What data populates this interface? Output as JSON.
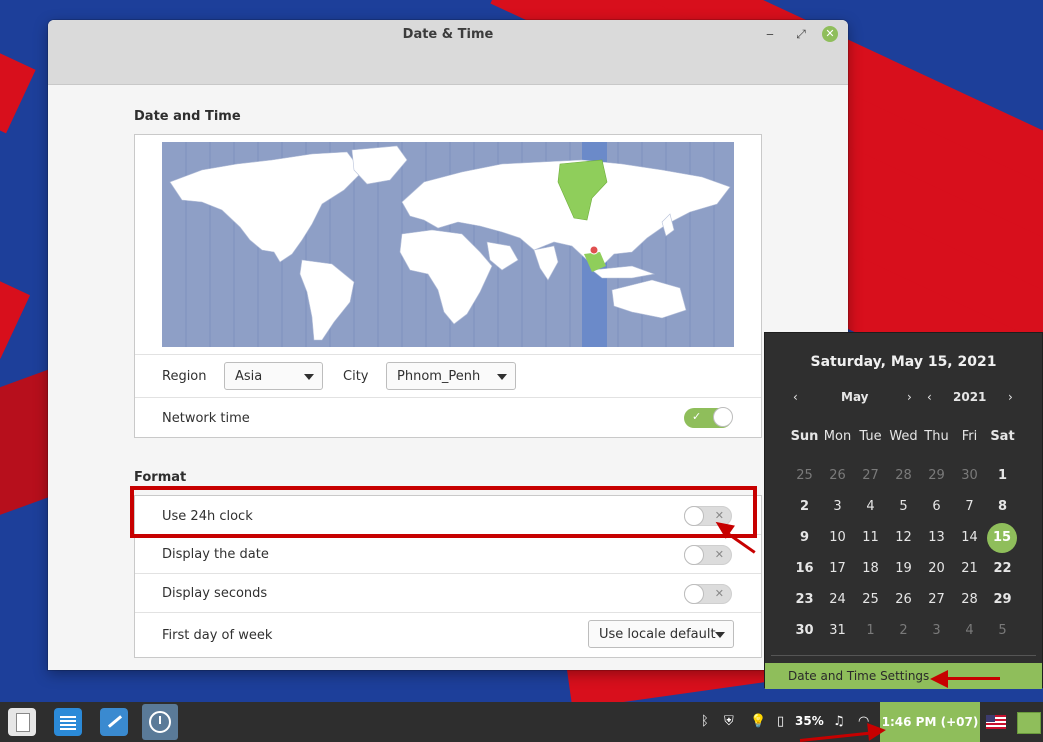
{
  "window": {
    "title": "Date & Time",
    "controls": {
      "minimize": "‒",
      "maximize": "⤢",
      "close": "✕"
    }
  },
  "date_time_section": {
    "title": "Date and Time",
    "region_label": "Region",
    "region_value": "Asia",
    "city_label": "City",
    "city_value": "Phnom_Penh",
    "network_time_label": "Network time",
    "network_time_on": true
  },
  "format_section": {
    "title": "Format",
    "use_24h_label": "Use 24h clock",
    "display_date_label": "Display the date",
    "display_seconds_label": "Display seconds",
    "first_day_label": "First day of week",
    "first_day_value": "Use locale default"
  },
  "calendar": {
    "header": "Saturday, May 15, 2021",
    "month": "May",
    "year": "2021",
    "weekdays": [
      "Sun",
      "Mon",
      "Tue",
      "Wed",
      "Thu",
      "Fri",
      "Sat"
    ],
    "weeks": [
      [
        "25",
        "26",
        "27",
        "28",
        "29",
        "30",
        "1"
      ],
      [
        "2",
        "3",
        "4",
        "5",
        "6",
        "7",
        "8"
      ],
      [
        "9",
        "10",
        "11",
        "12",
        "13",
        "14",
        "15"
      ],
      [
        "16",
        "17",
        "18",
        "19",
        "20",
        "21",
        "22"
      ],
      [
        "23",
        "24",
        "25",
        "26",
        "27",
        "28",
        "29"
      ],
      [
        "30",
        "31",
        "1",
        "2",
        "3",
        "4",
        "5"
      ]
    ],
    "today": "15",
    "settings_label": "Date and Time Settings"
  },
  "panel": {
    "battery": "35%",
    "clock": "1:46 PM (+07)"
  },
  "colors": {
    "accent": "#8fbe5b",
    "highlight": "#c70000",
    "calendar_bg": "#2f2f2f",
    "panel_bg": "#2e2e2e"
  }
}
